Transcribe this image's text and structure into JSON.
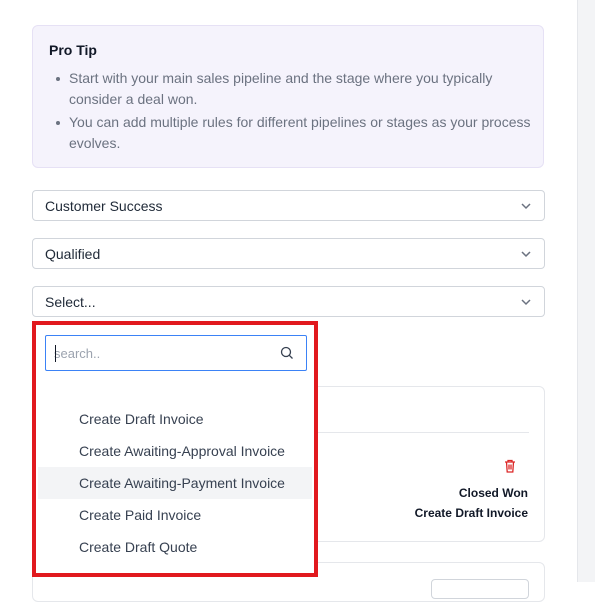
{
  "pro_tip": {
    "title": "Pro Tip",
    "bullets": [
      "Start with your main sales pipeline and the stage where you typically consider a deal won.",
      "You can add multiple rules for different pipelines or stages as your process evolves."
    ]
  },
  "selects": [
    {
      "value": "Customer Success"
    },
    {
      "value": "Qualified"
    },
    {
      "value": "Select..."
    }
  ],
  "dropdown": {
    "search_placeholder": "search..",
    "search_value": "",
    "options": [
      "Create Draft Invoice",
      "Create Awaiting-Approval Invoice",
      "Create Awaiting-Payment Invoice",
      "Create Paid Invoice",
      "Create Draft Quote"
    ],
    "highlighted_index": 2
  },
  "rule_card": {
    "stage": "Closed Won",
    "action": "Create Draft Invoice"
  },
  "colors": {
    "highlight_border": "#e1191e",
    "trash_icon": "#dc2626",
    "focus_border": "#3b82f6",
    "protip_bg": "#f5f3fc"
  }
}
